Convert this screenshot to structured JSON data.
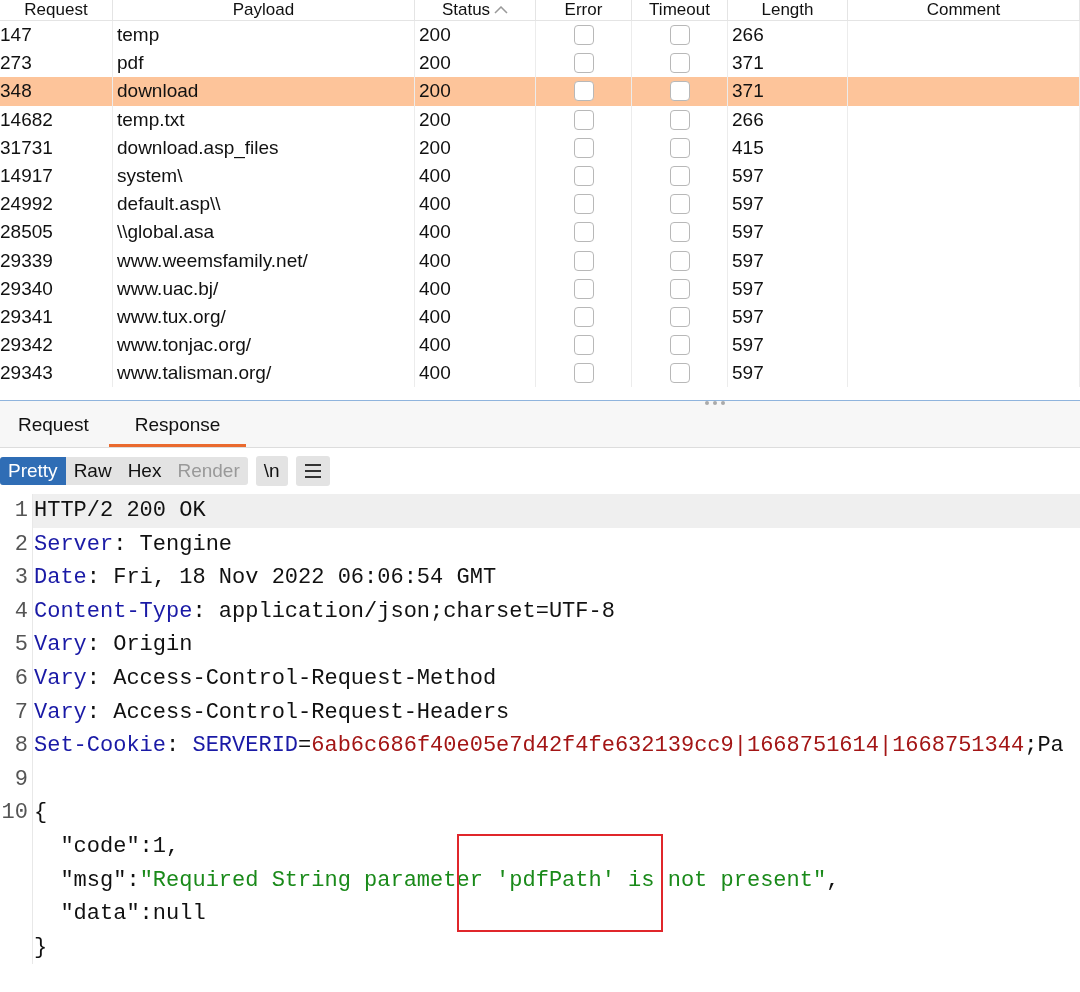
{
  "table": {
    "columns": [
      {
        "label": "Request",
        "sorted": false
      },
      {
        "label": "Payload",
        "sorted": false
      },
      {
        "label": "Status",
        "sorted": true
      },
      {
        "label": "Error",
        "sorted": false
      },
      {
        "label": "Timeout",
        "sorted": false
      },
      {
        "label": "Length",
        "sorted": false
      },
      {
        "label": "Comment",
        "sorted": false
      }
    ],
    "rows": [
      {
        "request": "147",
        "payload": "temp",
        "status": "200",
        "error": false,
        "timeout": false,
        "length": "266",
        "selected": false
      },
      {
        "request": "273",
        "payload": "pdf",
        "status": "200",
        "error": false,
        "timeout": false,
        "length": "371",
        "selected": false
      },
      {
        "request": "348",
        "payload": "download",
        "status": "200",
        "error": false,
        "timeout": false,
        "length": "371",
        "selected": true
      },
      {
        "request": "14682",
        "payload": "temp.txt",
        "status": "200",
        "error": false,
        "timeout": false,
        "length": "266",
        "selected": false
      },
      {
        "request": "31731",
        "payload": "download.asp_files",
        "status": "200",
        "error": false,
        "timeout": false,
        "length": "415",
        "selected": false
      },
      {
        "request": "14917",
        "payload": "system\\",
        "status": "400",
        "error": false,
        "timeout": false,
        "length": "597",
        "selected": false
      },
      {
        "request": "24992",
        "payload": "default.asp\\\\",
        "status": "400",
        "error": false,
        "timeout": false,
        "length": "597",
        "selected": false
      },
      {
        "request": "28505",
        "payload": "\\\\global.asa",
        "status": "400",
        "error": false,
        "timeout": false,
        "length": "597",
        "selected": false
      },
      {
        "request": "29339",
        "payload": "www.weemsfamily.net/",
        "status": "400",
        "error": false,
        "timeout": false,
        "length": "597",
        "selected": false
      },
      {
        "request": "29340",
        "payload": "www.uac.bj/",
        "status": "400",
        "error": false,
        "timeout": false,
        "length": "597",
        "selected": false
      },
      {
        "request": "29341",
        "payload": "www.tux.org/",
        "status": "400",
        "error": false,
        "timeout": false,
        "length": "597",
        "selected": false
      },
      {
        "request": "29342",
        "payload": "www.tonjac.org/",
        "status": "400",
        "error": false,
        "timeout": false,
        "length": "597",
        "selected": false
      },
      {
        "request": "29343",
        "payload": "www.talisman.org/",
        "status": "400",
        "error": false,
        "timeout": false,
        "length": "597",
        "selected": false
      }
    ]
  },
  "tabs": [
    {
      "label": "Request",
      "selected": false
    },
    {
      "label": "Response",
      "selected": true
    }
  ],
  "view_modes": [
    {
      "label": "Pretty",
      "selected": true,
      "disabled": false
    },
    {
      "label": "Raw",
      "selected": false,
      "disabled": false
    },
    {
      "label": "Hex",
      "selected": false,
      "disabled": false
    },
    {
      "label": "Render",
      "selected": false,
      "disabled": true
    }
  ],
  "newline_button": "\\n",
  "code_lines": [
    {
      "number": "1",
      "current": true,
      "tokens": [
        {
          "kind": "plain",
          "text": "HTTP/2 200 OK"
        }
      ]
    },
    {
      "number": "2",
      "current": false,
      "tokens": [
        {
          "kind": "key",
          "text": "Server"
        },
        {
          "kind": "plain",
          "text": ": Tengine"
        }
      ]
    },
    {
      "number": "3",
      "current": false,
      "tokens": [
        {
          "kind": "key",
          "text": "Date"
        },
        {
          "kind": "plain",
          "text": ": Fri, 18 Nov 2022 06:06:54 GMT"
        }
      ]
    },
    {
      "number": "4",
      "current": false,
      "tokens": [
        {
          "kind": "key",
          "text": "Content-Type"
        },
        {
          "kind": "plain",
          "text": ": application/json;charset=UTF-8"
        }
      ]
    },
    {
      "number": "5",
      "current": false,
      "tokens": [
        {
          "kind": "key",
          "text": "Vary"
        },
        {
          "kind": "plain",
          "text": ": Origin"
        }
      ]
    },
    {
      "number": "6",
      "current": false,
      "tokens": [
        {
          "kind": "key",
          "text": "Vary"
        },
        {
          "kind": "plain",
          "text": ": Access-Control-Request-Method"
        }
      ]
    },
    {
      "number": "7",
      "current": false,
      "tokens": [
        {
          "kind": "key",
          "text": "Vary"
        },
        {
          "kind": "plain",
          "text": ": Access-Control-Request-Headers"
        }
      ]
    },
    {
      "number": "8",
      "current": false,
      "tokens": [
        {
          "kind": "key",
          "text": "Set-Cookie"
        },
        {
          "kind": "plain",
          "text": ": "
        },
        {
          "kind": "key",
          "text": "SERVERID"
        },
        {
          "kind": "plain",
          "text": "="
        },
        {
          "kind": "value",
          "text": "6ab6c686f40e05e7d42f4fe632139cc9|1668751614|1668751344"
        },
        {
          "kind": "plain",
          "text": ";Pa"
        }
      ]
    },
    {
      "number": "9",
      "current": false
    },
    {
      "number": "10",
      "current": false,
      "tokens": [
        {
          "kind": "plain",
          "text": "{"
        }
      ]
    },
    {
      "current": false,
      "tokens": [
        {
          "kind": "plain",
          "text": "  \"code\":"
        },
        {
          "kind": "number",
          "text": "1"
        },
        {
          "kind": "plain",
          "text": ","
        }
      ]
    },
    {
      "current": false,
      "tokens": [
        {
          "kind": "plain",
          "text": "  \"msg\":"
        },
        {
          "kind": "string",
          "text": "\"Required String parameter 'pdfPath' is not present\""
        },
        {
          "kind": "plain",
          "text": ","
        }
      ]
    },
    {
      "current": false,
      "tokens": [
        {
          "kind": "plain",
          "text": "  \"data\":"
        },
        {
          "kind": "number",
          "text": "null"
        }
      ]
    },
    {
      "current": false,
      "tokens": [
        {
          "kind": "plain",
          "text": "}"
        }
      ]
    }
  ]
}
